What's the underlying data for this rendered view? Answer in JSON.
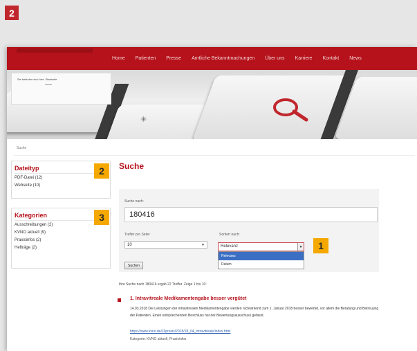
{
  "step_badge": "2",
  "nav": {
    "items": [
      "Home",
      "Patienten",
      "Presse",
      "Amtliche Bekanntmachungen",
      "Über uns",
      "Karriere",
      "Kontakt",
      "News"
    ]
  },
  "hero": {
    "text": "Sie befinden sich hier: Startseite"
  },
  "breadcrumb": "Suche",
  "filetype": {
    "title": "Dateityp",
    "items": [
      "PDF-Datei (12)",
      "Webseite (10)"
    ]
  },
  "categories": {
    "title": "Kategorien",
    "items": [
      "Ausschreibungen (2)",
      "KVNO aktuell (9)",
      "Praxisinfos (2)",
      "Hefträge (2)"
    ]
  },
  "callouts": [
    "1",
    "2",
    "3"
  ],
  "search": {
    "title": "Suche",
    "label": "Suche nach:",
    "query": "180416",
    "per_page_label": "Treffer pro Seite:",
    "per_page_value": "10",
    "sort_label": "Sortiert nach:",
    "sort_value": "Relevanz",
    "sort_options": [
      "Relevanz",
      "Datum"
    ],
    "submit_label": "Suchen"
  },
  "results": {
    "summary": "Ihre Suche nach 180416 ergab 22 Treffer. Zeige 1 bis 10:",
    "items": [
      {
        "title": "1. Intravitreale Medikamentengabe besser vergütet",
        "body": "14.03.2018 Die Leistungen der intravitrealen Medikamentengabe werden rückwirkend zum 1. Januar 2018 besser bewertet, vor allem die Beratung und Betreuung der Patienten. Einen entsprechenden Beschluss hat der Bewertungsausschuss gefasst.",
        "link": "https://www.kvno.de/10praxis/2018/18_04_intravitreale/index.html",
        "meta": "Kategorie: KVNO aktuell, Praxisinfos"
      }
    ]
  },
  "colors": {
    "brand_red": "#b5121b",
    "callout_orange": "#f5a800",
    "selected_blue": "#3b6fc4"
  }
}
